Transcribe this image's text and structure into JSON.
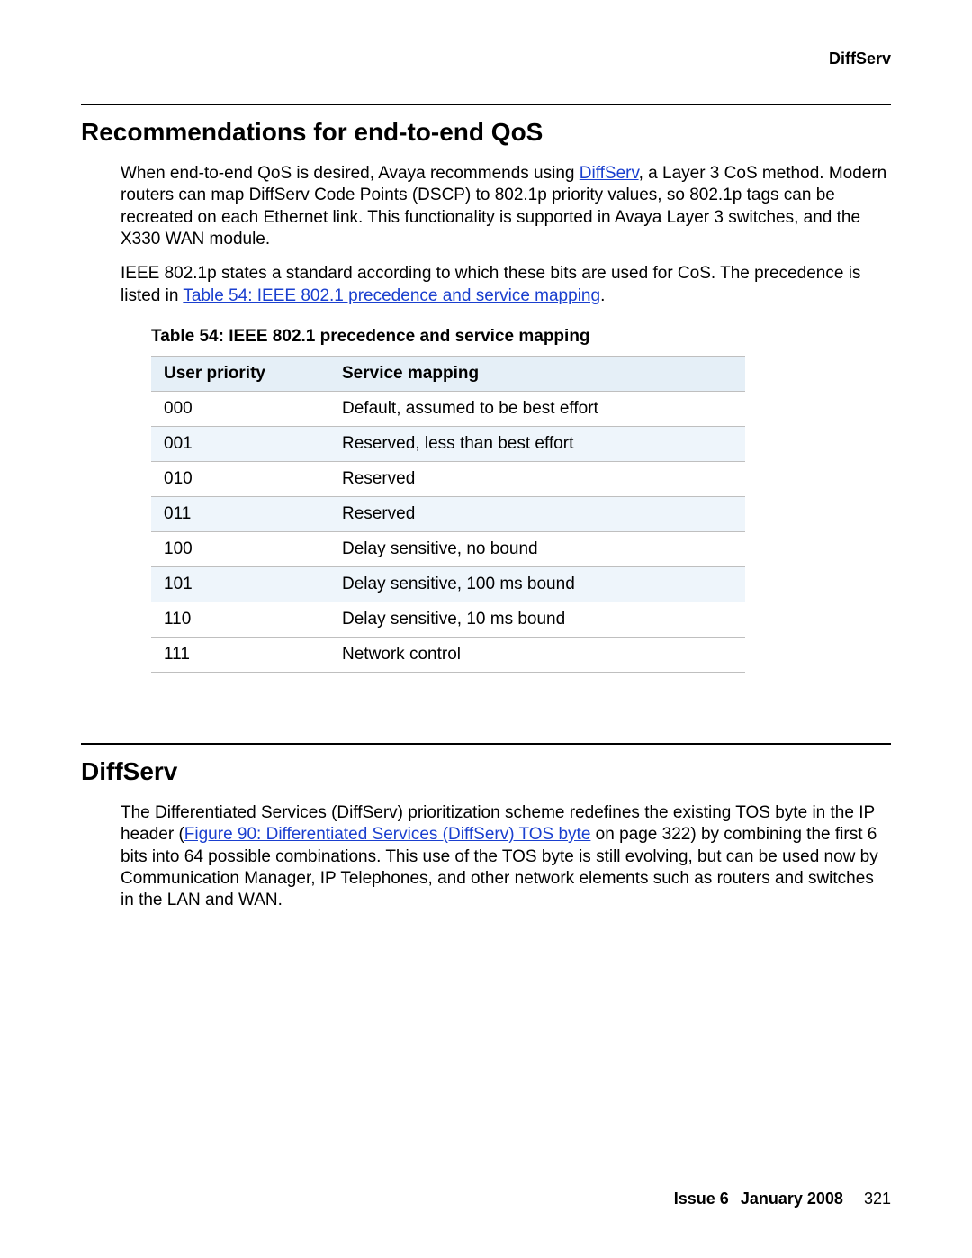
{
  "header": {
    "label": "DiffServ"
  },
  "section1": {
    "title": "Recommendations for end-to-end QoS",
    "para1_pre": "When end-to-end QoS is desired, Avaya recommends using ",
    "para1_link": "DiffServ",
    "para1_post": ", a Layer 3 CoS method. Modern routers can map DiffServ Code Points (DSCP) to 802.1p priority values, so 802.1p tags can be recreated on each Ethernet link. This functionality is supported in Avaya Layer 3 switches, and the X330 WAN module.",
    "para2_pre": "IEEE 802.1p states a standard according to which these bits are used for CoS. The precedence is listed in ",
    "para2_link": "Table 54:  IEEE 802.1 precedence and service mapping",
    "para2_post": "."
  },
  "table": {
    "caption": "Table 54: IEEE 802.1 precedence and service mapping",
    "headers": {
      "c1": "User priority",
      "c2": "Service mapping"
    },
    "rows": [
      {
        "priority": "000",
        "mapping": "Default, assumed to be best effort"
      },
      {
        "priority": "001",
        "mapping": "Reserved, less than best effort"
      },
      {
        "priority": "010",
        "mapping": "Reserved"
      },
      {
        "priority": "011",
        "mapping": "Reserved"
      },
      {
        "priority": "100",
        "mapping": "Delay sensitive, no bound"
      },
      {
        "priority": "101",
        "mapping": "Delay sensitive, 100 ms bound"
      },
      {
        "priority": "110",
        "mapping": "Delay sensitive, 10 ms bound"
      },
      {
        "priority": "111",
        "mapping": "Network control"
      }
    ]
  },
  "section2": {
    "title": "DiffServ",
    "para1_pre": "The Differentiated Services (DiffServ) prioritization scheme redefines the existing TOS byte in the IP header (",
    "para1_link": "Figure 90:  Differentiated Services (DiffServ) TOS byte",
    "para1_post": " on page 322) by combining the first 6 bits into 64 possible combinations. This use of the TOS byte is still evolving, but can be used now by Communication Manager, IP Telephones, and other network elements such as routers and switches in the LAN and WAN."
  },
  "footer": {
    "issue": "Issue 6",
    "date": "January 2008",
    "page": "321"
  },
  "chart_data": {
    "type": "table",
    "title": "Table 54: IEEE 802.1 precedence and service mapping",
    "columns": [
      "User priority",
      "Service mapping"
    ],
    "rows": [
      [
        "000",
        "Default, assumed to be best effort"
      ],
      [
        "001",
        "Reserved, less than best effort"
      ],
      [
        "010",
        "Reserved"
      ],
      [
        "011",
        "Reserved"
      ],
      [
        "100",
        "Delay sensitive, no bound"
      ],
      [
        "101",
        "Delay sensitive, 100 ms bound"
      ],
      [
        "110",
        "Delay sensitive, 10 ms bound"
      ],
      [
        "111",
        "Network control"
      ]
    ]
  }
}
